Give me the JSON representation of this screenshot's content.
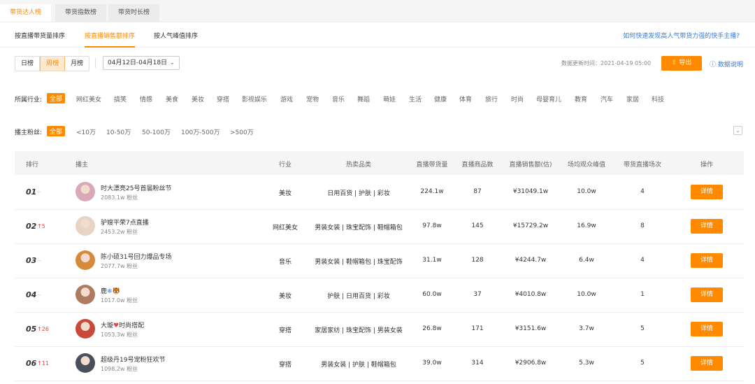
{
  "top_tabs": [
    "带货达人榜",
    "带货指数榜",
    "带货时长榜"
  ],
  "sort_tabs": [
    "按直播带货量排序",
    "按直播销售额排序",
    "按人气峰值排序"
  ],
  "help_link": "如何快速发现高人气带货力强的快手主播?",
  "period_tabs": [
    "日榜",
    "周榜",
    "月榜"
  ],
  "date_range": "04月12日-04月18日",
  "update_time": "数据更新时间：2021-04-19 05:00",
  "export_label": "导出",
  "data_help": "数据说明",
  "industry_label": "所属行业:",
  "industries": [
    "全部",
    "网红美女",
    "搞笑",
    "情感",
    "美食",
    "美妆",
    "穿搭",
    "影视娱乐",
    "游戏",
    "宠物",
    "音乐",
    "舞蹈",
    "萌娃",
    "生活",
    "健康",
    "体育",
    "旅行",
    "时尚",
    "母婴育儿",
    "教育",
    "汽车",
    "家居",
    "科技"
  ],
  "fans_label": "播主粉丝:",
  "fans_ranges": [
    "全部",
    "<10万",
    "10-50万",
    "50-100万",
    "100万-500万",
    ">500万"
  ],
  "columns": [
    "排行",
    "播主",
    "行业",
    "热卖品类",
    "直播带货量",
    "直播商品数",
    "直播销售额(估)",
    "场均观众峰值",
    "带货直播场次",
    "操作"
  ],
  "rows": [
    {
      "rank": "01",
      "change": "--",
      "change_type": "same",
      "name": "时大漂亮25号首届粉丝节",
      "fans": "2083.1w 粉丝",
      "industry": "美妆",
      "category": "日用百货 | 护肤 | 彩妆",
      "volume": "224.1w",
      "products": "87",
      "sales": "¥31049.1w",
      "peak": "10.0w",
      "sessions": "4",
      "action": "详情",
      "avatar_color": "#d9a9b8"
    },
    {
      "rank": "02",
      "change": "5",
      "change_type": "up",
      "name": "驴嫂平荣7点直播",
      "fans": "2453.2w 粉丝",
      "industry": "网红美女",
      "category": "男装女装 | 珠宝配饰 | 鞋帽箱包",
      "volume": "97.8w",
      "products": "145",
      "sales": "¥15729.2w",
      "peak": "16.9w",
      "sessions": "8",
      "action": "详情",
      "avatar_color": "#e8d3c4"
    },
    {
      "rank": "03",
      "change": "--",
      "change_type": "same",
      "name": "陈小硕31号回力爆品专场",
      "fans": "2077.7w 粉丝",
      "industry": "音乐",
      "category": "男装女装 | 鞋帽箱包 | 珠宝配饰",
      "volume": "31.1w",
      "products": "128",
      "sales": "¥4244.7w",
      "peak": "6.4w",
      "sessions": "4",
      "action": "详情",
      "avatar_color": "#d68a3c"
    },
    {
      "rank": "04",
      "change": "--",
      "change_type": "same",
      "name": "鹿",
      "name_emoji": "❄🐯",
      "fans": "1017.0w 粉丝",
      "industry": "美妆",
      "category": "护肤 | 日用百货 | 彩妆",
      "volume": "60.0w",
      "products": "37",
      "sales": "¥4010.8w",
      "peak": "10.0w",
      "sessions": "1",
      "action": "详情",
      "avatar_color": "#b07a62"
    },
    {
      "rank": "05",
      "change": "26",
      "change_type": "up",
      "name": "大璇",
      "name_emoji": "♥",
      "name_suffix": "时尚搭配",
      "fans": "1053.3w 粉丝",
      "industry": "穿搭",
      "category": "家居家纺 | 珠宝配饰 | 男装女装",
      "volume": "26.8w",
      "products": "171",
      "sales": "¥3151.6w",
      "peak": "3.7w",
      "sessions": "5",
      "action": "详情",
      "avatar_color": "#c94a3a"
    },
    {
      "rank": "06",
      "change": "11",
      "change_type": "up",
      "name": "超级丹19号宠粉狂欢节",
      "fans": "1098.2w 粉丝",
      "industry": "穿搭",
      "category": "男装女装 | 护肤 | 鞋帽箱包",
      "volume": "39.0w",
      "products": "314",
      "sales": "¥2906.8w",
      "peak": "5.3w",
      "sessions": "5",
      "action": "详情",
      "avatar_color": "#4a4f5c"
    }
  ],
  "colors": {
    "accent": "#ff8a00",
    "link": "#3a7bd5",
    "up": "#e54545"
  }
}
